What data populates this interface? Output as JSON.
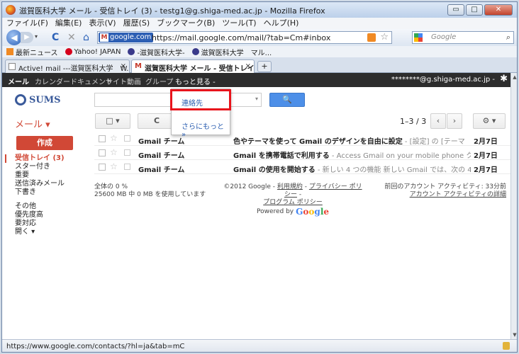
{
  "window": {
    "title": "滋賀医科大学 メール - 受信トレイ (3) - testg1@g.shiga-med.ac.jp - Mozilla Firefox",
    "buttons": {
      "minimize": "▭",
      "maximize": "□",
      "close": "✕"
    }
  },
  "menubar": [
    "ファイル(F)",
    "編集(E)",
    "表示(V)",
    "履歴(S)",
    "ブックマーク(B)",
    "ツール(T)",
    "ヘルプ(H)"
  ],
  "navbar": {
    "back": "◀",
    "forward": "▶",
    "dropdown": "▾",
    "reload": "C",
    "stop": "✕",
    "home": "⌂",
    "site_badge": "google.com",
    "site_badge_letter": "M",
    "url": "https://mail.google.com/mail/?tab=Cm#inbox",
    "star": "☆",
    "search_placeholder": "Google",
    "search_icon": "⌕"
  },
  "bookmarks": [
    {
      "label": "最新ニュース",
      "icon_color": "#f08a24"
    },
    {
      "label": "Yahoo! JAPAN",
      "icon_color": "#d6001c"
    },
    {
      "label": "-滋賀医科大学-",
      "icon_color": "#3a3a8a"
    },
    {
      "label": "滋賀医科大学　マル...",
      "icon_color": "#3a3a8a"
    }
  ],
  "tabs": [
    {
      "label": "Active! mail ---滋賀医科大学　W...",
      "close": "×",
      "active": false
    },
    {
      "label": "滋賀医科大学 メール - 受信トレイ...",
      "close": "×",
      "active": true
    }
  ],
  "newtab": "+",
  "gbar": {
    "items": [
      "メール",
      "カレンダー",
      "ドキュメント",
      "サイト",
      "動画",
      "グループ",
      "もっと見る -"
    ],
    "user": "********@g.shiga-med.ac.jp -",
    "gear": "✱"
  },
  "dropdown": {
    "items": [
      "連絡先",
      "さらにもっと »"
    ]
  },
  "header": {
    "logo_text": "SUMS",
    "search_dd": "▾",
    "search_button": "🔍"
  },
  "toolbar": {
    "mail_label": "メール ▾",
    "select_btn": "□ ▾",
    "refresh_btn": "C",
    "page_count": "1–3 / 3",
    "prev": "‹",
    "next": "›",
    "settings_btn": "⚙ ▾"
  },
  "sidebar": {
    "compose": "作成",
    "items": [
      {
        "label": "受信トレイ (3)",
        "active": true
      },
      {
        "label": "スター付き"
      },
      {
        "label": "重要"
      },
      {
        "label": "送信済みメール"
      },
      {
        "label": "下書き"
      },
      {
        "label": ""
      },
      {
        "label": "その他"
      },
      {
        "label": "優先度高"
      },
      {
        "label": "要対応"
      },
      {
        "label": "開く ▾"
      }
    ]
  },
  "messages": [
    {
      "sender": "Gmail チーム",
      "subject": "色やテーマを使って Gmail のデザインを自由に設定",
      "snippet": " - [設定] の [テーマ",
      "date": "2月7日"
    },
    {
      "sender": "Gmail チーム",
      "subject": "Gmail を携帯電話で利用する",
      "snippet": " - Access Gmail on your mobile phone ク",
      "date": "2月7日"
    },
    {
      "sender": "Gmail チーム",
      "subject": "Gmail の使用を開始する",
      "snippet": " - 新しい 4 つの機能 新しい Gmail では、次の 4",
      "date": "2月7日"
    }
  ],
  "footer": {
    "storage_line1": "全体の 0 %",
    "storage_line2": "25600 MB 中 0 MB を使用しています",
    "copyright": "©2012 Google - ",
    "terms": "利用規約",
    "sep": " - ",
    "privacy": "プライバシー ポリシー",
    "program_policy": "プログラム ポリシー",
    "powered_by": "Powered by",
    "google_logo": "Google",
    "activity_line1": "前回のアカウント アクティビティ: 33分前",
    "activity_line2": "アカウント アクティビティの詳細"
  },
  "statusbar": {
    "url": "https://www.google.com/contacts/?hl=ja&tab=mC"
  },
  "scroll": {
    "up": "▲",
    "down": "▼"
  },
  "colors": {
    "gmail_red": "#d14836",
    "highlight_red": "#e8141c",
    "link_blue": "#2a5db0",
    "google_blue": "#4d8fe8"
  }
}
